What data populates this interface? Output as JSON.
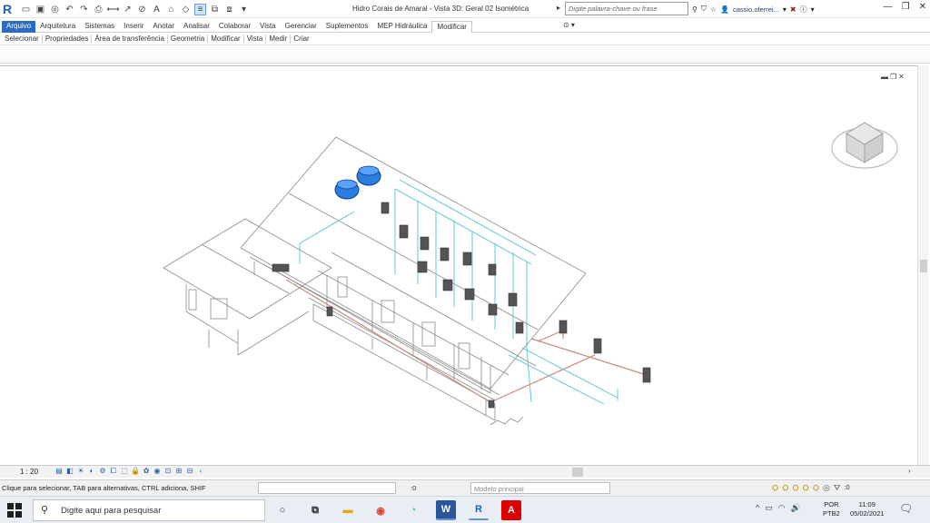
{
  "titlebar": {
    "app_logo": "R",
    "title": "Hidro Corais de Amaral - Vista 3D: Geral 02 Isométrica",
    "search_placeholder": "Digite palavra-chave ou frase",
    "user": "cassio.oferrei...",
    "help": "?"
  },
  "menu": {
    "tabs": [
      "Arquivo",
      "Arquitetura",
      "Sistemas",
      "Inserir",
      "Anotar",
      "Analisar",
      "Colaborar",
      "Vista",
      "Gerenciar",
      "Suplementos",
      "MEP Hidráulica",
      "Modificar"
    ],
    "active_tab": "Modificar"
  },
  "panels": [
    "Selecionar",
    "Propriedades",
    "Área de transferência",
    "Geometria",
    "Modificar",
    "Vista",
    "Medir",
    "Criar"
  ],
  "viewbar": {
    "scale": "1 : 20"
  },
  "statusbar": {
    "hint": "Clique para selecionar, TAB para alternativas, CTRL adiciona, SHIF",
    "worksets": ":0",
    "model": "Modelo principal",
    "filter": ":0"
  },
  "taskbar": {
    "search_placeholder": "Digite aqui para pesquisar",
    "lang_line1": "POR",
    "lang_line2": "PTB2",
    "time": "11:09",
    "date": "05/02/2021"
  },
  "colors": {
    "water_blue": "#2b7de0",
    "pipe_cyan": "#4fc3d8",
    "pipe_brown": "#c98a7a",
    "building_line": "#8a8a8a"
  }
}
